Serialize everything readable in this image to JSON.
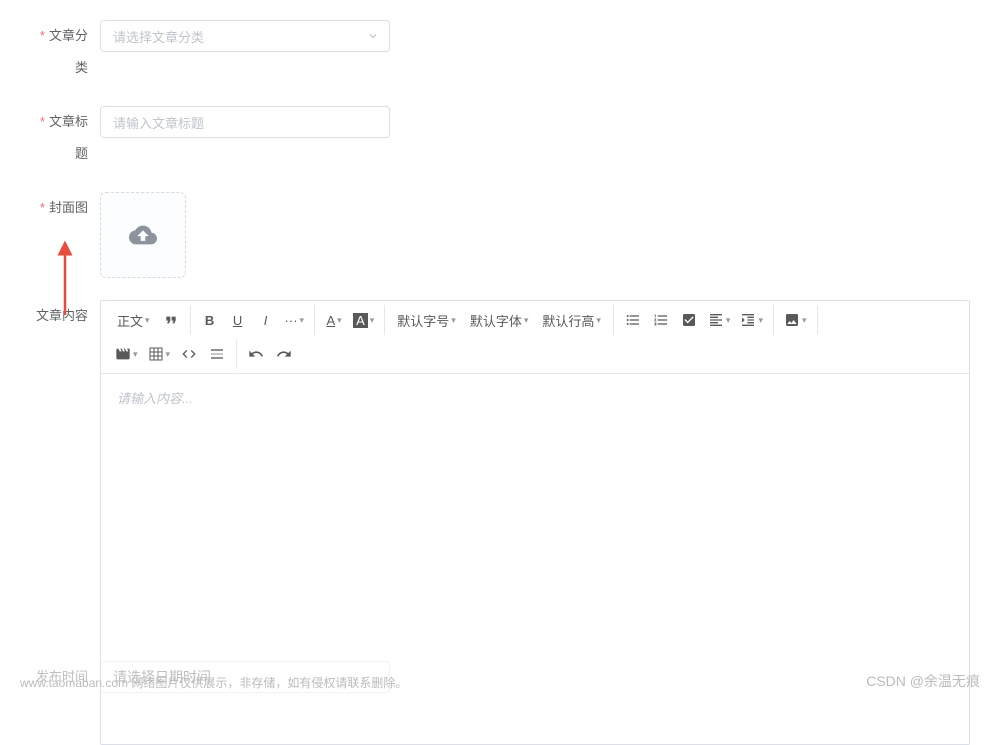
{
  "form": {
    "category": {
      "label": "文章分类",
      "placeholder": "请选择文章分类"
    },
    "title": {
      "label": "文章标题",
      "placeholder": "请输入文章标题"
    },
    "cover": {
      "label": "封面图"
    },
    "content": {
      "label": "文章内容",
      "placeholder": "请输入内容..."
    },
    "publishTime": {
      "label": "发布时间",
      "placeholder": "请选择日期时间"
    }
  },
  "toolbar": {
    "heading": "正文",
    "fontSize": "默认字号",
    "fontFamily": "默认字体",
    "lineHeight": "默认行高"
  },
  "watermark": {
    "left": "www.taomaban.com 网络图片仅供展示，非存储，如有侵权请联系删除。",
    "right": "CSDN @余温无痕"
  }
}
